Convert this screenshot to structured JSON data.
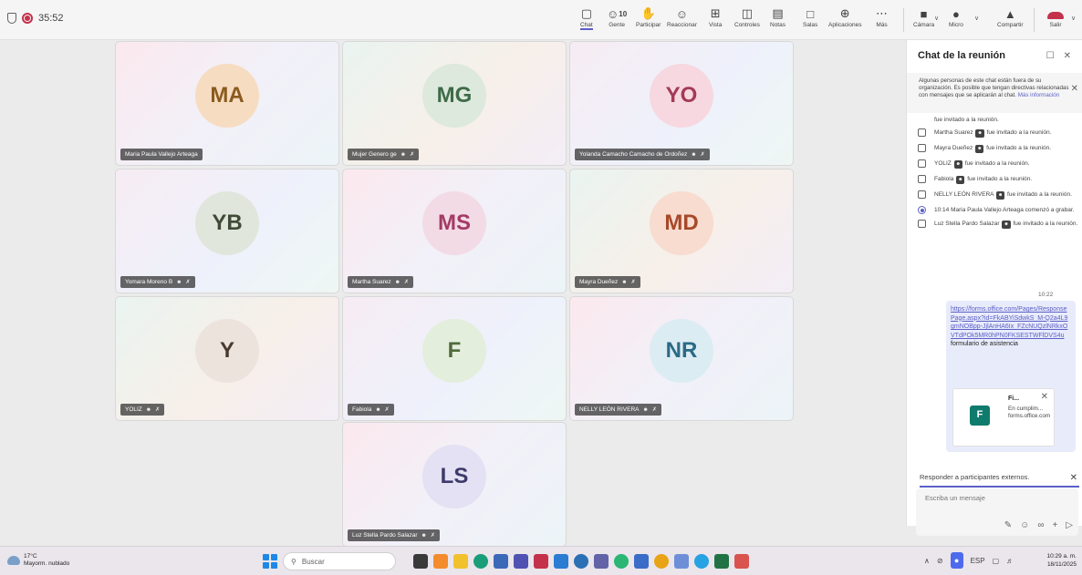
{
  "topbar": {
    "timer": "35:52",
    "buttons": [
      {
        "name": "chat",
        "label": "Chat",
        "icon": "chat-icon"
      },
      {
        "name": "people",
        "label": "Gente",
        "icon": "people-icon",
        "count": "10"
      },
      {
        "name": "raise",
        "label": "Participar",
        "icon": "hand-icon"
      },
      {
        "name": "react",
        "label": "Reaccionar",
        "icon": "emoji-icon"
      },
      {
        "name": "view",
        "label": "Vista",
        "icon": "grid-icon"
      },
      {
        "name": "controls",
        "label": "Controles",
        "icon": "controls-icon"
      },
      {
        "name": "notes",
        "label": "Notas",
        "icon": "notes-icon"
      },
      {
        "name": "rooms",
        "label": "Salas",
        "icon": "rooms-icon"
      },
      {
        "name": "apps",
        "label": "Aplicaciones",
        "icon": "plus-icon"
      },
      {
        "name": "more",
        "label": "Más",
        "icon": "more-icon"
      }
    ],
    "camera_label": "Cámara",
    "mic_label": "Micro",
    "share_label": "Compartir",
    "leave_label": "Salir"
  },
  "participants": [
    {
      "initials": "MA",
      "name": "Maria Paula Vallejo Arteaga",
      "color": "#f6dcc1",
      "text": "#8a5a1f"
    },
    {
      "initials": "MG",
      "name": "Mujer Genero ge",
      "color": "#dde9dd",
      "text": "#3e6b48"
    },
    {
      "initials": "YO",
      "name": "Yolanda Camacho Camacho de Ordoñez",
      "color": "#f7d8e0",
      "text": "#a33a56"
    },
    {
      "initials": "YB",
      "name": "Yomara Moreno B",
      "color": "#e1e6dc",
      "text": "#3f4a37"
    },
    {
      "initials": "MS",
      "name": "Martha Suarez",
      "color": "#f3dbe5",
      "text": "#a33a66"
    },
    {
      "initials": "MD",
      "name": "Mayra Dueñez",
      "color": "#f7dccf",
      "text": "#a8482a"
    },
    {
      "initials": "Y",
      "name": "YOLIZ",
      "color": "#ece3dc",
      "text": "#4a3a2e"
    },
    {
      "initials": "F",
      "name": "Fabiola",
      "color": "#e4eedd",
      "text": "#4e6b3a"
    },
    {
      "initials": "NR",
      "name": "NELLY LEÓN RIVERA",
      "color": "#dcecf3",
      "text": "#2b6a86"
    },
    {
      "initials": "LS",
      "name": "Luz Stella Pardo Salazar",
      "color": "#e3e1f3",
      "text": "#3e3a6b"
    }
  ],
  "chat": {
    "title": "Chat de la reunión",
    "notice": "Algunas personas de este chat están fuera de su organización. Es posible que tengan directivas relacionadas con mensajes que se aplicarán al chat.",
    "notice_link": "Más información",
    "events": [
      {
        "icon": "invite-icon",
        "who": "",
        "text": "fue invitado a la reunión.",
        "ext": false
      },
      {
        "icon": "invite-icon",
        "who": "Martha Suarez",
        "text": "fue invitado a la reunión.",
        "ext": true
      },
      {
        "icon": "invite-icon",
        "who": "Mayra Dueñez",
        "text": "fue invitado a la reunión.",
        "ext": true
      },
      {
        "icon": "invite-icon",
        "who": "YOLIZ",
        "text": "fue invitado a la reunión.",
        "ext": true
      },
      {
        "icon": "invite-icon",
        "who": "Fabiola",
        "text": "fue invitado a la reunión.",
        "ext": true
      },
      {
        "icon": "invite-icon",
        "who": "NELLY LEÓN RIVERA",
        "text": "fue invitado a la reunión.",
        "ext": true
      },
      {
        "icon": "record-icon",
        "who": "10:14  Maria Paula Vallejo Arteaga",
        "text": "comenzó a grabar.",
        "ext": false
      },
      {
        "icon": "invite-icon",
        "who": "Luz Stella Pardo Salazar",
        "text": "fue invitado a la reunión.",
        "ext": true
      }
    ],
    "message_time": "10:22",
    "message_link": "https://forms.office.com/Pages/ResponsePage.aspx?id=FkABYiSdwkS_M-Q2a4L9gmNOBpp-JjlAnHA6Ix_FZcNUQzlNRkxOVTdPOk5MR0hPN0FKSESTWFlDVS4u",
    "message_text": "formulario de asistencia",
    "card_title": "Fi...",
    "card_desc": "En cumplim... forms.office.com",
    "reply_label": "Responder a participantes externos.",
    "compose_placeholder": "Escriba un mensaje"
  },
  "taskbar": {
    "temp": "17°C",
    "weather": "Mayorm. nublado",
    "search_placeholder": "Buscar",
    "lang": "ESP",
    "time": "10:29 a. m.",
    "date": "18/11/2025"
  }
}
